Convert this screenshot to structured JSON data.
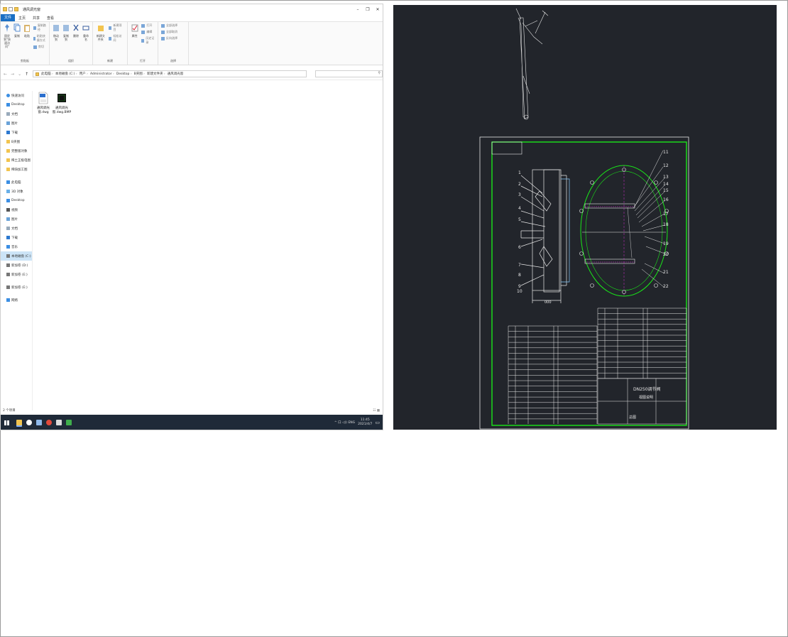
{
  "explorer": {
    "window_title": "通风调光窗",
    "window_controls": [
      "–",
      "❐",
      "✕"
    ],
    "tabs": [
      "文件",
      "主页",
      "共享",
      "查看"
    ],
    "ribbon": {
      "groups": [
        {
          "label": "剪贴板",
          "buttons": [
            "固定到\"快速访问\"",
            "复制",
            "粘贴"
          ],
          "small": [
            "复制路径",
            "粘贴快捷方式",
            "剪切"
          ]
        },
        {
          "label": "组织",
          "buttons": [
            "移动到",
            "复制到",
            "删除",
            "重命名"
          ],
          "small": []
        },
        {
          "label": "新建",
          "buttons": [
            "新建文件夹"
          ],
          "small": [
            "新建项目",
            "轻松访问"
          ]
        },
        {
          "label": "打开",
          "buttons": [
            "属性"
          ],
          "small": [
            "打开",
            "编辑",
            "历史记录"
          ]
        },
        {
          "label": "选择",
          "buttons": [],
          "small": [
            "全部选择",
            "全部取消",
            "反向选择"
          ]
        }
      ]
    },
    "address": {
      "nav_arrows": [
        "←",
        "→",
        "⌄",
        "↑"
      ],
      "path": [
        "此电脑",
        "本地磁盘 (C:)",
        "用户",
        "Administrator",
        "Desktop",
        "B夹图",
        "新建文件夹",
        "通风调光窗"
      ],
      "search_icon": "⚲"
    },
    "nav_pane": {
      "quick_access": "快速访问",
      "quick_items": [
        "Desktop",
        "文档",
        "图片",
        "下载",
        "B夹图",
        "完整版对象",
        "稀土正极电图",
        "稀缺加工图"
      ],
      "this_pc": "此电脑",
      "pc_items": [
        "3D 对象",
        "Desktop",
        "视频",
        "图片",
        "文档",
        "下载",
        "音乐",
        "本地磁盘 (C:)",
        "新加卷 (D:)",
        "新加卷 (E:)"
      ],
      "drive2": "新加卷 (E:)",
      "network": "网络"
    },
    "files": [
      {
        "name": "通风调光窗.dwg",
        "type": "dwg"
      },
      {
        "name": "通风调光窗.dwg.BMP",
        "type": "bmp"
      }
    ],
    "status": "2 个项目",
    "status_views": "☷ ▦"
  },
  "taskbar": {
    "apps": [
      "file-explorer",
      "cortana",
      "notepad",
      "chrome",
      "paint",
      "wechat"
    ],
    "tray_text": "^ 口 ◁)) ENG",
    "time": "11:45",
    "date": "2021/4/7"
  },
  "cad": {
    "title_text": "DN250调节阀",
    "subtitle_text": "视图说明",
    "note": "总图",
    "balloons": [
      "1",
      "2",
      "3",
      "4",
      "5",
      "6",
      "7",
      "8",
      "9",
      "10",
      "11",
      "12",
      "13",
      "14",
      "15",
      "16",
      "17",
      "18",
      "19",
      "20",
      "21",
      "22"
    ]
  },
  "colors": {
    "cad_bg": "#22252b",
    "cad_border_green": "#19e619",
    "cad_line_white": "#e8e8e8",
    "taskbar_bg": "#1f2a38",
    "accent": "#1a6fc4"
  }
}
